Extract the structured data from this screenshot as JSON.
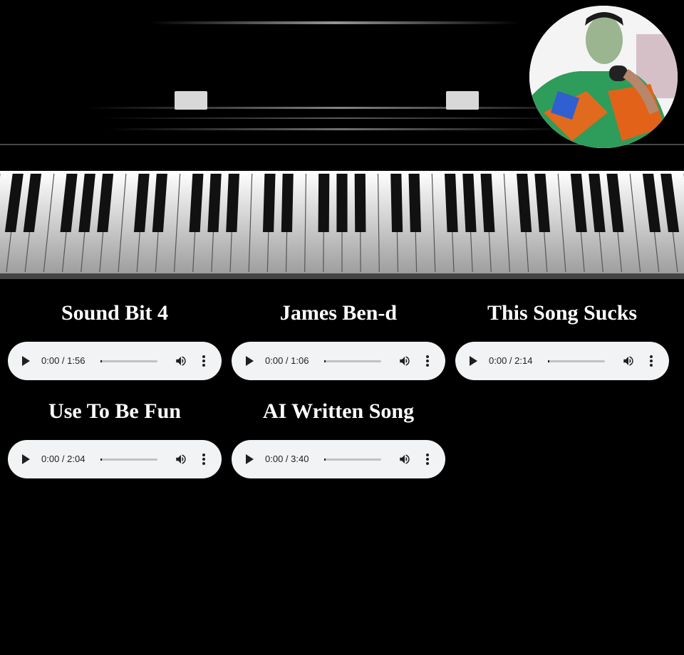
{
  "tracks": [
    {
      "title": "Sound Bit 4",
      "time": "0:00 / 1:56"
    },
    {
      "title": "James Ben-d",
      "time": "0:00 / 1:06"
    },
    {
      "title": "This Song Sucks",
      "time": "0:00 / 2:14"
    },
    {
      "title": "Use To Be Fun",
      "time": "0:00 / 2:04"
    },
    {
      "title": "AI Written Song",
      "time": "0:00 / 3:40"
    }
  ],
  "icons": {
    "play": "play-icon",
    "volume": "volume-icon",
    "more": "more-options-icon"
  },
  "colors": {
    "background": "#000000",
    "player": "#f1f3f4",
    "title": "#ffffff"
  }
}
